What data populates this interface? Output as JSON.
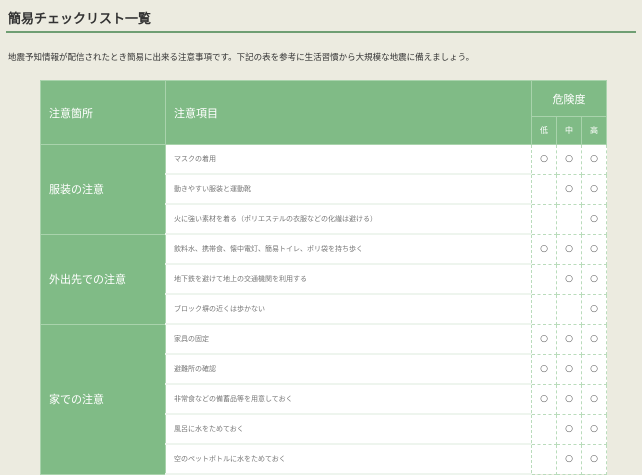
{
  "title": "簡易チェックリスト一覧",
  "description": "地震予知情報が配信されたとき簡易に出来る注意事項です。下記の表を参考に生活習慣から大規模な地震に備えましょう。",
  "table": {
    "headers": {
      "place": "注意箇所",
      "item": "注意項目",
      "danger": "危険度",
      "low": "低",
      "mid": "中",
      "high": "高"
    },
    "mark": "○",
    "groups": [
      {
        "label": "服装の注意",
        "rows": [
          {
            "item": "マスクの着用",
            "levels": [
              true,
              true,
              true
            ]
          },
          {
            "item": "動きやすい服装と運動靴",
            "levels": [
              false,
              true,
              true
            ]
          },
          {
            "item": "火に強い素材を着る（ポリエステルの衣服などの化繊は避ける）",
            "levels": [
              false,
              false,
              true
            ]
          }
        ]
      },
      {
        "label": "外出先での注意",
        "rows": [
          {
            "item": "飲料水、携帯食、懐中電灯、簡易トイレ、ポリ袋を持ち歩く",
            "levels": [
              true,
              true,
              true
            ]
          },
          {
            "item": "地下鉄を避けて地上の交通機関を利用する",
            "levels": [
              false,
              true,
              true
            ]
          },
          {
            "item": "ブロック塀の近くは歩かない",
            "levels": [
              false,
              false,
              true
            ]
          }
        ]
      },
      {
        "label": "家での注意",
        "rows": [
          {
            "item": "家具の固定",
            "levels": [
              true,
              true,
              true
            ]
          },
          {
            "item": "避難所の確認",
            "levels": [
              true,
              true,
              true
            ]
          },
          {
            "item": "非常食などの備蓄品等を用意しておく",
            "levels": [
              true,
              true,
              true
            ]
          },
          {
            "item": "風呂に水をためておく",
            "levels": [
              false,
              true,
              true
            ]
          },
          {
            "item": "空のペットボトルに水をためておく",
            "levels": [
              false,
              true,
              true
            ]
          }
        ]
      }
    ]
  }
}
